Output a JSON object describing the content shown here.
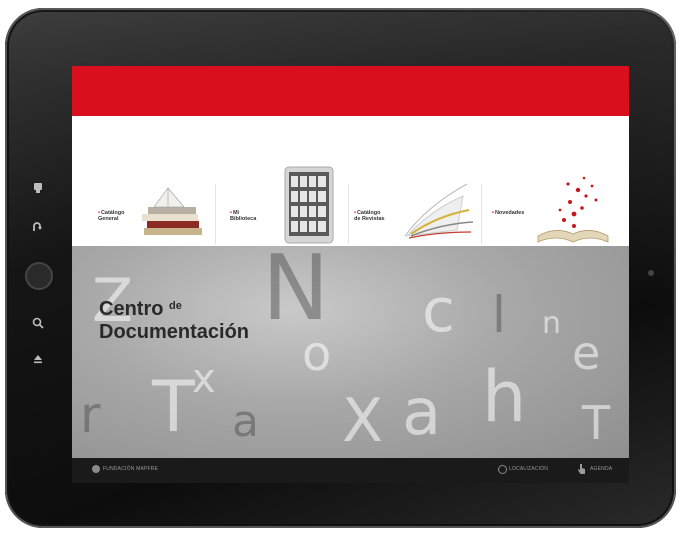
{
  "menu": {
    "items": [
      {
        "label": "Catálogo\nGeneral",
        "icon": "stacked-books-icon"
      },
      {
        "label": "Mi\nBiblioteca",
        "icon": "tablet-bookshelf-icon"
      },
      {
        "label": "Catálogo\nde Revistas",
        "icon": "open-magazine-icon"
      },
      {
        "label": "Novedades",
        "icon": "open-book-petals-icon"
      }
    ]
  },
  "hero": {
    "title_line1": "Centro",
    "title_de": "de",
    "title_line2": "Documentación"
  },
  "footer": {
    "left_label": "FUNDACIÓN MAPFRE",
    "links": [
      "LOCALIZACIÓN",
      "AGENDA"
    ]
  },
  "colors": {
    "brand_red": "#d90f1d",
    "footer_bg": "#1a1a1a",
    "device_frame": "#151515"
  },
  "device": {
    "side_icons": [
      "plug-icon",
      "back-arrow-icon",
      "home-button",
      "search-icon",
      "eject-icon"
    ]
  }
}
